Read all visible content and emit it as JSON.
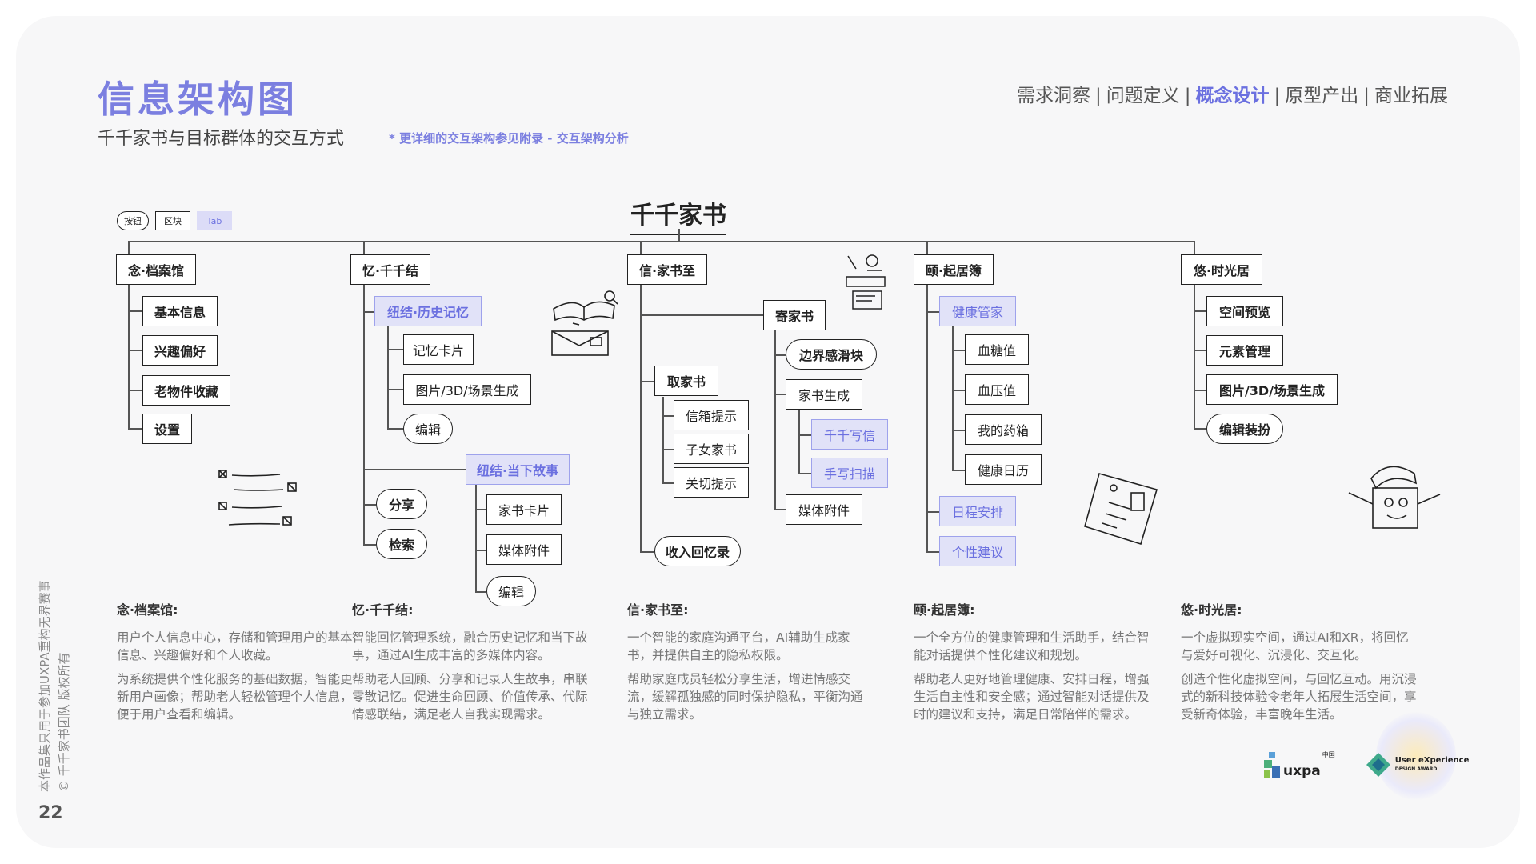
{
  "header": {
    "title": "信息架构图",
    "subtitle": "千千家书与目标群体的交互方式",
    "note": "* 更详细的交互架构参见附录 - 交互架构分析"
  },
  "nav": {
    "items": [
      "需求洞察",
      "问题定义",
      "概念设计",
      "原型产出",
      "商业拓展"
    ],
    "active": "概念设计",
    "separator": "|"
  },
  "legend": {
    "button": "按钮",
    "block": "区块",
    "tab": "Tab"
  },
  "diagram": {
    "root": "千千家书",
    "col1": {
      "head": "念·档案馆",
      "items": [
        "基本信息",
        "兴趣偏好",
        "老物件收藏",
        "设置"
      ]
    },
    "col2": {
      "head": "忆·千千结",
      "tab1": "纽结·历史记忆",
      "tab1_items": [
        "记忆卡片",
        "图片/3D/场景生成"
      ],
      "tab1_btn": "编辑",
      "tab2": "纽结·当下故事",
      "tab2_items": [
        "家书卡片",
        "媒体附件"
      ],
      "tab2_btn": "编辑",
      "btn_share": "分享",
      "btn_search": "检索"
    },
    "col3": {
      "head": "信·家书至",
      "send": "寄家书",
      "send_btn": "边界感滑块",
      "gen": "家书生成",
      "gen_tabs": [
        "千千写信",
        "手写扫描"
      ],
      "media": "媒体附件",
      "take": "取家书",
      "take_items": [
        "信箱提示",
        "子女家书",
        "关切提示"
      ],
      "collect_btn": "收入回忆录"
    },
    "col4": {
      "head": "颐·起居簿",
      "tab1": "健康管家",
      "tab1_items": [
        "血糖值",
        "血压值",
        "我的药箱",
        "健康日历"
      ],
      "tab2": "日程安排",
      "tab3": "个性建议"
    },
    "col5": {
      "head": "悠·时光居",
      "items": [
        "空间预览",
        "元素管理",
        "图片/3D/场景生成"
      ],
      "btn": "编辑装扮"
    }
  },
  "descriptions": [
    {
      "title": "念·档案馆:",
      "p1": "用户个人信息中心，存储和管理用户的基本信息、兴趣偏好和个人收藏。",
      "p2": "为系统提供个性化服务的基础数据，智能更新用户画像；帮助老人轻松管理个人信息，便于用户查看和编辑。"
    },
    {
      "title": "忆·千千结:",
      "p1": "智能回忆管理系统，融合历史记忆和当下故事，通过AI生成丰富的多媒体内容。",
      "p2": "帮助老人回顾、分享和记录人生故事，串联零散记忆。促进生命回顾、价值传承、代际情感联结，满足老人自我实现需求。"
    },
    {
      "title": "信·家书至:",
      "p1": "一个智能的家庭沟通平台，AI辅助生成家书，并提供自主的隐私权限。",
      "p2": "帮助家庭成员轻松分享生活，增进情感交流，缓解孤独感的同时保护隐私，平衡沟通与独立需求。"
    },
    {
      "title": "颐·起居簿:",
      "p1": "一个全方位的健康管理和生活助手，结合智能对话提供个性化建议和规划。",
      "p2": "帮助老人更好地管理健康、安排日程，增强生活自主性和安全感；通过智能对话提供及时的建议和支持，满足日常陪伴的需求。"
    },
    {
      "title": "悠·时光居:",
      "p1": "一个虚拟现实空间，通过AI和XR，将回忆与爱好可视化、沉浸化、交互化。",
      "p2": "创造个性化虚拟空间，与回忆互动。用沉浸式的新科技体验令老年人拓展生活空间，享受新奇体验，丰富晚年生活。"
    }
  ],
  "footer": {
    "vertical_line1": "本作品集只用于参加UXPA重构无界赛事",
    "vertical_line2": "© 千千家书团队 版权所有",
    "page_number": "22",
    "logo_uxpa": "uxpa",
    "logo_uxpa_sup": "中国",
    "logo_ux_line1": "User eXperience",
    "logo_ux_line2": "DESIGN AWARD"
  },
  "colors": {
    "accent": "#7b7fe0",
    "tab_bg": "#e1e2f8",
    "background": "#f7f7f8"
  }
}
